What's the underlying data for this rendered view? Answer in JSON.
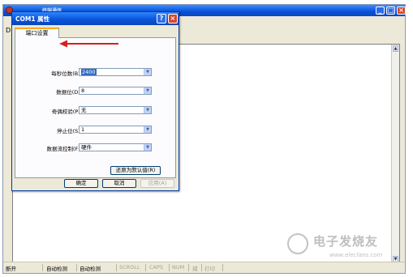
{
  "main_window": {
    "title": "终端通信",
    "toolbar_stub": "D",
    "status": {
      "connection": "断开",
      "detect1": "自动检测",
      "detect2": "自动检测",
      "scroll": "SCROLL",
      "caps": "CAPS",
      "num": "NUM",
      "capture": "捕",
      "print": "打印"
    },
    "watermark_text": "电子发烧友",
    "watermark_url": "www.elecfans.com"
  },
  "dialog": {
    "title": "COM1 属性",
    "tab_label": "端口设置",
    "fields": [
      {
        "label": "每秒位数(B):",
        "value": "2400"
      },
      {
        "label": "数据位(D):",
        "value": "8"
      },
      {
        "label": "奇偶校验(P):",
        "value": "无"
      },
      {
        "label": "停止位(S):",
        "value": "1"
      },
      {
        "label": "数据流控制(F):",
        "value": "硬件"
      }
    ],
    "restore_button": "还原为默认值(R)",
    "ok_button": "确定",
    "cancel_button": "取消",
    "apply_button": "应用(A)"
  },
  "colors": {
    "annotation_arrow": "#d6201a",
    "title_blue": "#0a55dc"
  }
}
